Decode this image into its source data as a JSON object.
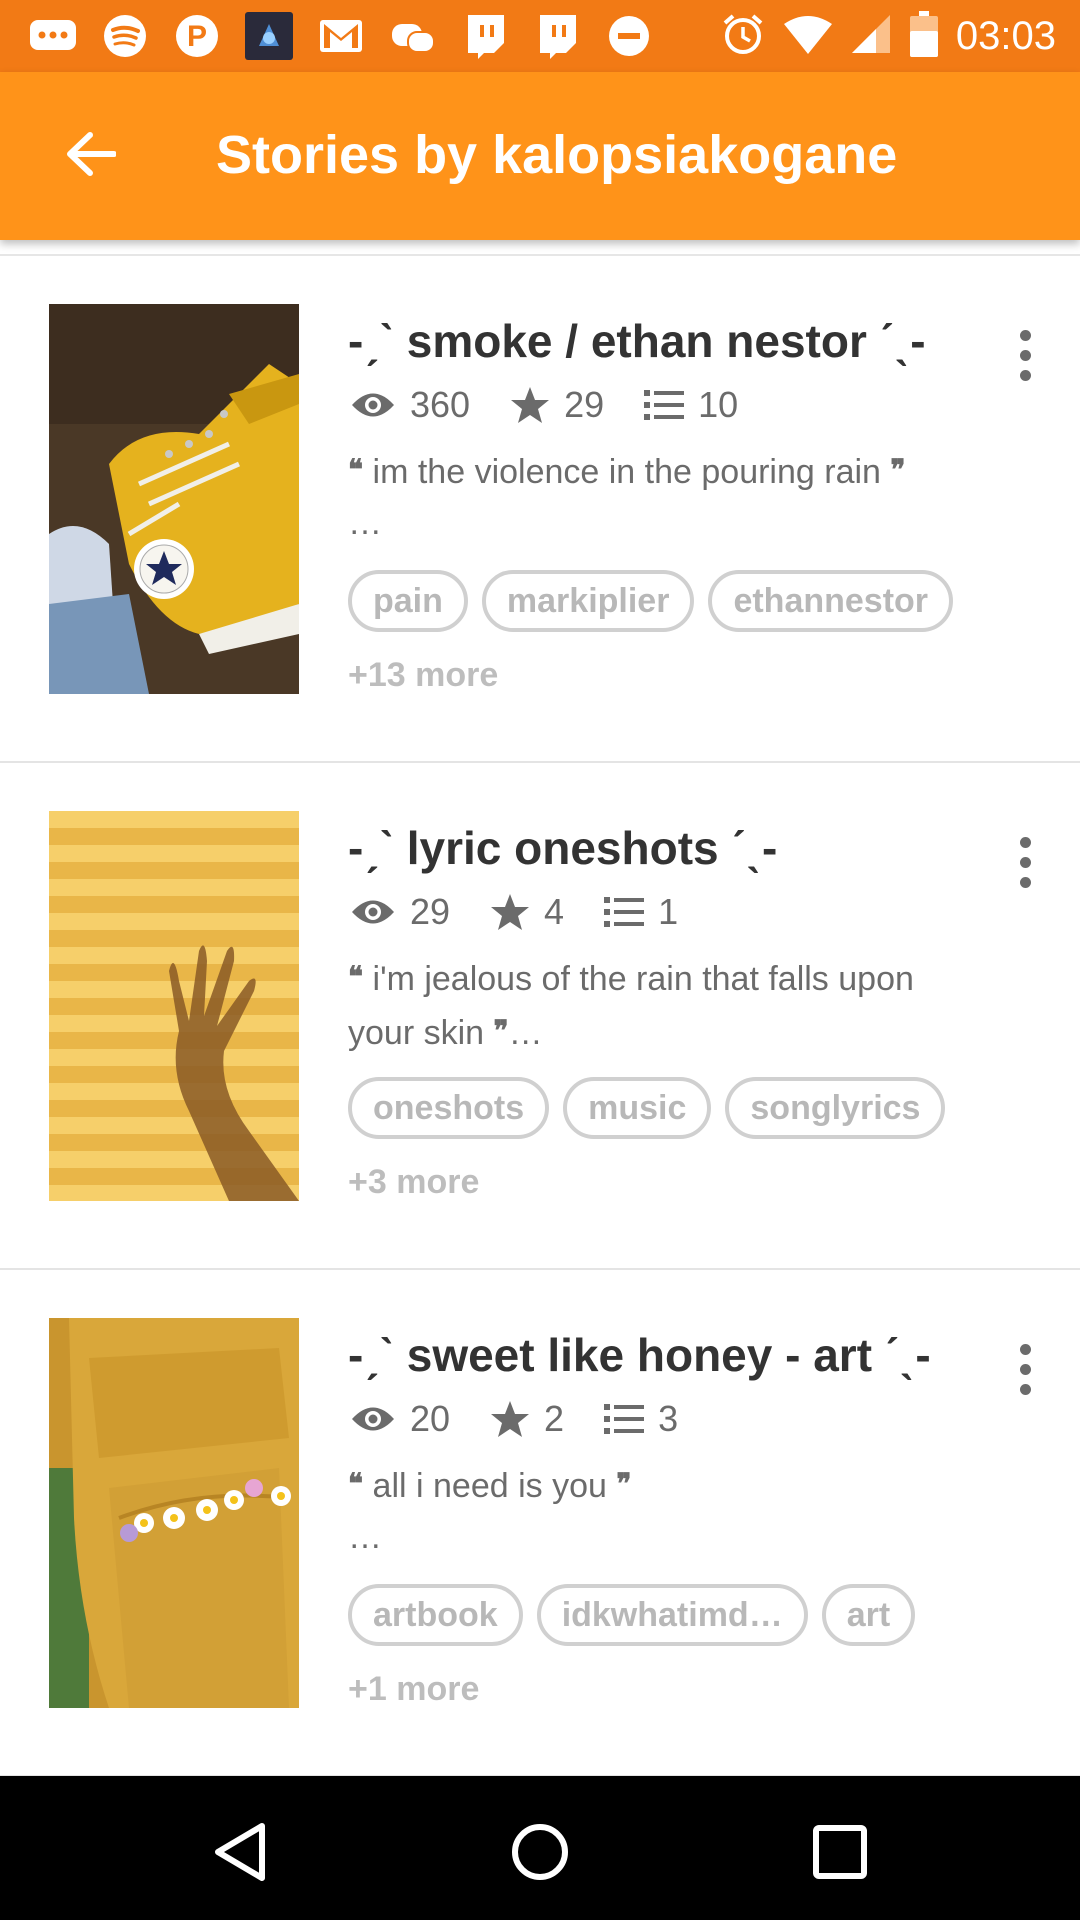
{
  "status_bar": {
    "time": "03:03",
    "notification_icons": [
      "chat-bubble-icon",
      "spotify-icon",
      "pinterest-icon",
      "app-thumbnail-icon",
      "gmail-icon",
      "gamepad-icon",
      "twitch-icon",
      "twitch-icon",
      "do-not-disturb-icon"
    ],
    "system_icons": [
      "alarm-icon",
      "wifi-icon",
      "signal-icon",
      "battery-icon"
    ]
  },
  "app_bar": {
    "title": "Stories by kalopsiakogane",
    "background": "#ff9319"
  },
  "stories": [
    {
      "title": "-ˏˋ smoke / ethan nestor ˊˎ-",
      "views": "360",
      "votes": "29",
      "parts": "10",
      "description": "im the violence in the pouring rain",
      "description_tail": "…",
      "tags": [
        "pain",
        "markiplier",
        "ethannestor"
      ],
      "more_tags": "+13 more",
      "cover": "yellow-converse-sneaker"
    },
    {
      "title": "-ˏˋ lyric oneshots ˊˎ-",
      "views": "29",
      "votes": "4",
      "parts": "1",
      "description": "i'm jealous of the rain that falls upon your skin",
      "description_tail": "…",
      "tags": [
        "oneshots",
        "music",
        "songlyrics"
      ],
      "more_tags": "+3 more",
      "cover": "hand-shadow-on-yellow-wall"
    },
    {
      "title": "-ˏˋ sweet like honey - art ˊˎ-",
      "views": "20",
      "votes": "2",
      "parts": "3",
      "description": "all i need is you",
      "description_tail": "…",
      "tags": [
        "artbook",
        "idkwhatimd…",
        "art"
      ],
      "more_tags": "+1 more",
      "cover": "yellow-backpack-with-flowers"
    }
  ],
  "colors": {
    "status_bar": "#f27a15",
    "accent": "#ff9319",
    "meta_text": "#6b6b6b",
    "tag_text": "#b8b8b8"
  }
}
